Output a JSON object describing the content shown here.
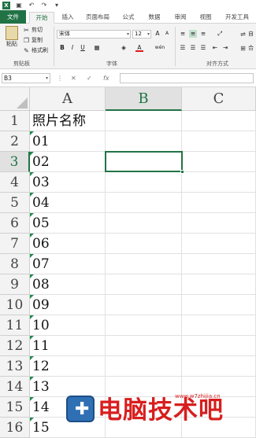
{
  "app": {
    "logo_letter": "X"
  },
  "tabs": [
    "文件",
    "开始",
    "插入",
    "页面布局",
    "公式",
    "数据",
    "审阅",
    "视图",
    "开发工具"
  ],
  "ribbon": {
    "paste_label": "粘贴",
    "cut_label": "剪切",
    "copy_label": "复制",
    "format_painter_label": "格式刷",
    "clipboard_group": "剪贴板",
    "font_name": "宋体",
    "font_size": "12",
    "grow_font": "A",
    "shrink_font": "A",
    "bold": "B",
    "italic": "I",
    "underline": "U",
    "font_color_letter": "A",
    "phonetic_label": "wén",
    "font_group": "字体",
    "wrap_label": "自",
    "merge_label": "合",
    "align_group": "对齐方式"
  },
  "formula_bar": {
    "name_box": "B3",
    "fx_label": "fx",
    "value": ""
  },
  "columns": [
    "A",
    "B",
    "C"
  ],
  "selected_column": "B",
  "selected_row": "3",
  "rows": [
    {
      "num": "1",
      "a": "照片名称"
    },
    {
      "num": "2",
      "a": "01"
    },
    {
      "num": "3",
      "a": "02"
    },
    {
      "num": "4",
      "a": "03"
    },
    {
      "num": "5",
      "a": "04"
    },
    {
      "num": "6",
      "a": "05"
    },
    {
      "num": "7",
      "a": "06"
    },
    {
      "num": "8",
      "a": "07"
    },
    {
      "num": "9",
      "a": "08"
    },
    {
      "num": "10",
      "a": "09"
    },
    {
      "num": "11",
      "a": "10"
    },
    {
      "num": "12",
      "a": "11"
    },
    {
      "num": "13",
      "a": "12"
    },
    {
      "num": "14",
      "a": "13"
    },
    {
      "num": "15",
      "a": "14"
    },
    {
      "num": "16",
      "a": "15"
    }
  ],
  "watermark": {
    "text": "电脑技术吧",
    "url": "www.w7zhijia.cn"
  },
  "colors": {
    "accent": "#217346",
    "watermark_red": "#d81e1e"
  }
}
